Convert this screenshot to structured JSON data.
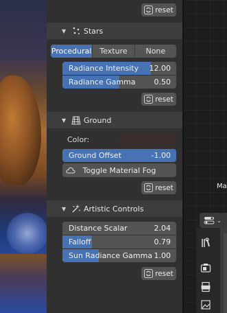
{
  "panel": {
    "top_reset": {
      "label": "reset"
    },
    "stars": {
      "title": "Stars",
      "icon": "stars-icon",
      "tabs": [
        {
          "label": "Procedural",
          "active": true
        },
        {
          "label": "Texture",
          "active": false
        },
        {
          "label": "None",
          "active": false
        }
      ],
      "radiance_intensity": {
        "label": "Radiance Intensity",
        "value": "12.00",
        "fill": 0.78
      },
      "radiance_gamma": {
        "label": "Radiance Gamma",
        "value": "0.50",
        "fill": 0.5
      },
      "reset": {
        "label": "reset"
      }
    },
    "ground": {
      "title": "Ground",
      "icon": "ground-grid-icon",
      "color_label": "Color:",
      "color_value": "#3a2d2d",
      "ground_offset": {
        "label": "Ground Offset",
        "value": "-1.00",
        "fill": 1.0
      },
      "toggle_fog": {
        "label": "Toggle Material Fog"
      },
      "reset": {
        "label": "reset"
      }
    },
    "artistic": {
      "title": "Artistic Controls",
      "icon": "sparkle-wand-icon",
      "distance_scalar": {
        "label": "Distance Scalar",
        "value": "2.04",
        "fill": 0.0
      },
      "falloff": {
        "label": "Falloff",
        "value": "0.79",
        "fill": 0.26
      },
      "sun_radiance_gamma": {
        "label": "Sun Radiance Gamma",
        "value": "1.00",
        "fill": 0.32
      },
      "reset": {
        "label": "reset"
      }
    }
  },
  "node_editor": {
    "partial_text": "Ma"
  },
  "colors": {
    "accent": "#4772b3",
    "panel_bg": "#303030",
    "header_bg": "#3d3d3d",
    "widget_bg": "#545454"
  }
}
